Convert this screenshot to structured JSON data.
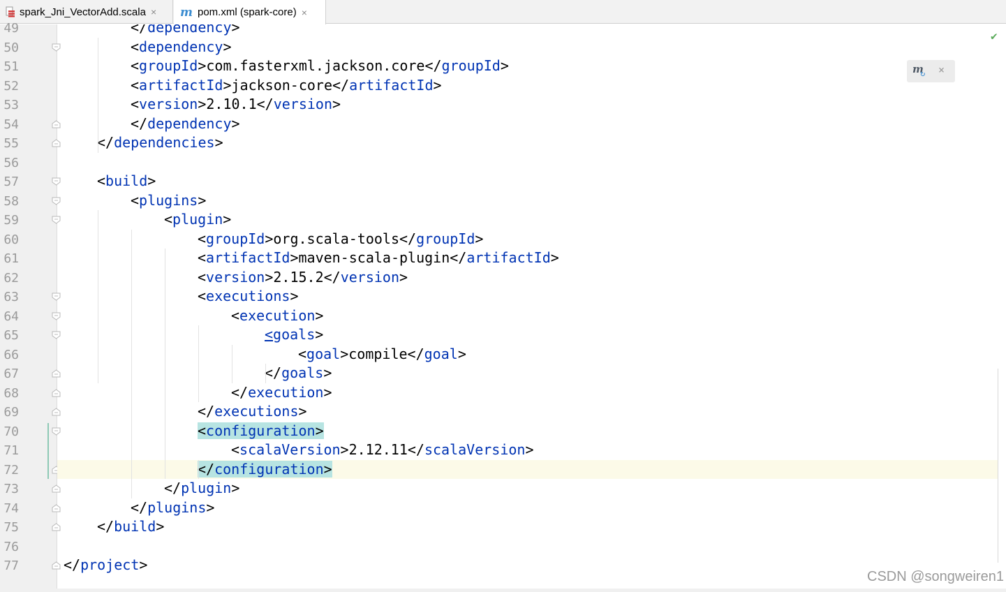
{
  "tabs": [
    {
      "label": "spark_Jni_VectorAdd.scala",
      "icon": "scala-file-icon",
      "active": false
    },
    {
      "label": "pom.xml (spark-core)",
      "icon": "maven-icon",
      "active": true
    }
  ],
  "tab_close_glyph": "×",
  "maven_glyph": "m",
  "lines": [
    {
      "n": "49",
      "indent": 2,
      "parts": [
        [
          "p",
          "</"
        ],
        [
          "t",
          "dependency"
        ],
        [
          "p",
          ">"
        ]
      ]
    },
    {
      "n": "50",
      "indent": 2,
      "parts": [
        [
          "p",
          "<"
        ],
        [
          "t",
          "dependency"
        ],
        [
          "p",
          ">"
        ]
      ]
    },
    {
      "n": "51",
      "indent": 2,
      "parts": [
        [
          "p",
          "<"
        ],
        [
          "t",
          "groupId"
        ],
        [
          "p",
          ">com.fasterxml.jackson.core</"
        ],
        [
          "t",
          "groupId"
        ],
        [
          "p",
          ">"
        ]
      ]
    },
    {
      "n": "52",
      "indent": 2,
      "parts": [
        [
          "p",
          "<"
        ],
        [
          "t",
          "artifactId"
        ],
        [
          "p",
          ">jackson-core</"
        ],
        [
          "t",
          "artifactId"
        ],
        [
          "p",
          ">"
        ]
      ]
    },
    {
      "n": "53",
      "indent": 2,
      "parts": [
        [
          "p",
          "<"
        ],
        [
          "t",
          "version"
        ],
        [
          "p",
          ">2.10.1</"
        ],
        [
          "t",
          "version"
        ],
        [
          "p",
          ">"
        ]
      ]
    },
    {
      "n": "54",
      "indent": 2,
      "parts": [
        [
          "p",
          "</"
        ],
        [
          "t",
          "dependency"
        ],
        [
          "p",
          ">"
        ]
      ]
    },
    {
      "n": "55",
      "indent": 1,
      "parts": [
        [
          "p",
          "</"
        ],
        [
          "t",
          "dependencies"
        ],
        [
          "p",
          ">"
        ]
      ]
    },
    {
      "n": "56",
      "indent": 0,
      "parts": []
    },
    {
      "n": "57",
      "indent": 1,
      "parts": [
        [
          "p",
          "<"
        ],
        [
          "t",
          "build"
        ],
        [
          "p",
          ">"
        ]
      ]
    },
    {
      "n": "58",
      "indent": 2,
      "parts": [
        [
          "p",
          "<"
        ],
        [
          "t",
          "plugins"
        ],
        [
          "p",
          ">"
        ]
      ]
    },
    {
      "n": "59",
      "indent": 3,
      "parts": [
        [
          "p",
          "<"
        ],
        [
          "t",
          "plugin"
        ],
        [
          "p",
          ">"
        ]
      ]
    },
    {
      "n": "60",
      "indent": 4,
      "parts": [
        [
          "p",
          "<"
        ],
        [
          "t",
          "groupId"
        ],
        [
          "p",
          ">org.scala-tools</"
        ],
        [
          "t",
          "groupId"
        ],
        [
          "p",
          ">"
        ]
      ]
    },
    {
      "n": "61",
      "indent": 4,
      "parts": [
        [
          "p",
          "<"
        ],
        [
          "t",
          "artifactId"
        ],
        [
          "p",
          ">maven-scala-plugin</"
        ],
        [
          "t",
          "artifactId"
        ],
        [
          "p",
          ">"
        ]
      ]
    },
    {
      "n": "62",
      "indent": 4,
      "parts": [
        [
          "p",
          "<"
        ],
        [
          "t",
          "version"
        ],
        [
          "p",
          ">2.15.2</"
        ],
        [
          "t",
          "version"
        ],
        [
          "p",
          ">"
        ]
      ]
    },
    {
      "n": "63",
      "indent": 4,
      "parts": [
        [
          "p",
          "<"
        ],
        [
          "t",
          "executions"
        ],
        [
          "p",
          ">"
        ]
      ]
    },
    {
      "n": "64",
      "indent": 5,
      "parts": [
        [
          "p",
          "<"
        ],
        [
          "t",
          "execution"
        ],
        [
          "p",
          ">"
        ]
      ]
    },
    {
      "n": "65",
      "indent": 6,
      "parts": [
        [
          "u",
          "<"
        ],
        [
          "t",
          "goals"
        ],
        [
          "p",
          ">"
        ]
      ]
    },
    {
      "n": "66",
      "indent": 7,
      "parts": [
        [
          "p",
          "<"
        ],
        [
          "t",
          "goal"
        ],
        [
          "p",
          ">compile</"
        ],
        [
          "t",
          "goal"
        ],
        [
          "p",
          ">"
        ]
      ]
    },
    {
      "n": "67",
      "indent": 6,
      "parts": [
        [
          "p",
          "</"
        ],
        [
          "t",
          "goals"
        ],
        [
          "p",
          ">"
        ]
      ]
    },
    {
      "n": "68",
      "indent": 5,
      "parts": [
        [
          "p",
          "</"
        ],
        [
          "t",
          "execution"
        ],
        [
          "p",
          ">"
        ]
      ]
    },
    {
      "n": "69",
      "indent": 4,
      "parts": [
        [
          "p",
          "</"
        ],
        [
          "t",
          "executions"
        ],
        [
          "p",
          ">"
        ]
      ]
    },
    {
      "n": "70",
      "indent": 4,
      "parts": [
        [
          "hp",
          "<"
        ],
        [
          "ht",
          "configuration"
        ],
        [
          "hp",
          ">"
        ]
      ]
    },
    {
      "n": "71",
      "indent": 5,
      "parts": [
        [
          "p",
          "<"
        ],
        [
          "t",
          "scalaVersion"
        ],
        [
          "p",
          ">2.12.11</"
        ],
        [
          "t",
          "scalaVersion"
        ],
        [
          "p",
          ">"
        ]
      ]
    },
    {
      "n": "72",
      "indent": 4,
      "current": true,
      "parts": [
        [
          "hp",
          "</"
        ],
        [
          "ht",
          "configuration"
        ],
        [
          "hp",
          ">"
        ]
      ]
    },
    {
      "n": "73",
      "indent": 3,
      "parts": [
        [
          "p",
          "</"
        ],
        [
          "t",
          "plugin"
        ],
        [
          "p",
          ">"
        ]
      ]
    },
    {
      "n": "74",
      "indent": 2,
      "parts": [
        [
          "p",
          "</"
        ],
        [
          "t",
          "plugins"
        ],
        [
          "p",
          ">"
        ]
      ]
    },
    {
      "n": "75",
      "indent": 1,
      "parts": [
        [
          "p",
          "</"
        ],
        [
          "t",
          "build"
        ],
        [
          "p",
          ">"
        ]
      ]
    },
    {
      "n": "76",
      "indent": 0,
      "parts": []
    },
    {
      "n": "77",
      "indent": 0,
      "parts": [
        [
          "p",
          "</"
        ],
        [
          "t",
          "project"
        ],
        [
          "p",
          ">"
        ]
      ]
    }
  ],
  "folds": {
    "start": [
      "50",
      "57",
      "58",
      "59",
      "63",
      "64",
      "65",
      "70"
    ],
    "end": [
      "54",
      "55",
      "67",
      "68",
      "69",
      "72",
      "73",
      "74",
      "75",
      "77"
    ]
  },
  "status": {
    "check_glyph": "✔"
  },
  "maven_popup": {
    "icon": "maven-reload-icon",
    "m_glyph": "m",
    "reload_glyph": "↻",
    "close_glyph": "×"
  },
  "watermark": "CSDN @songweiren1",
  "colors": {
    "tag": "#0033b3",
    "highlight": "#b7e4e2",
    "current_line": "#fcfae8",
    "gutter": "#f0f0f0"
  }
}
